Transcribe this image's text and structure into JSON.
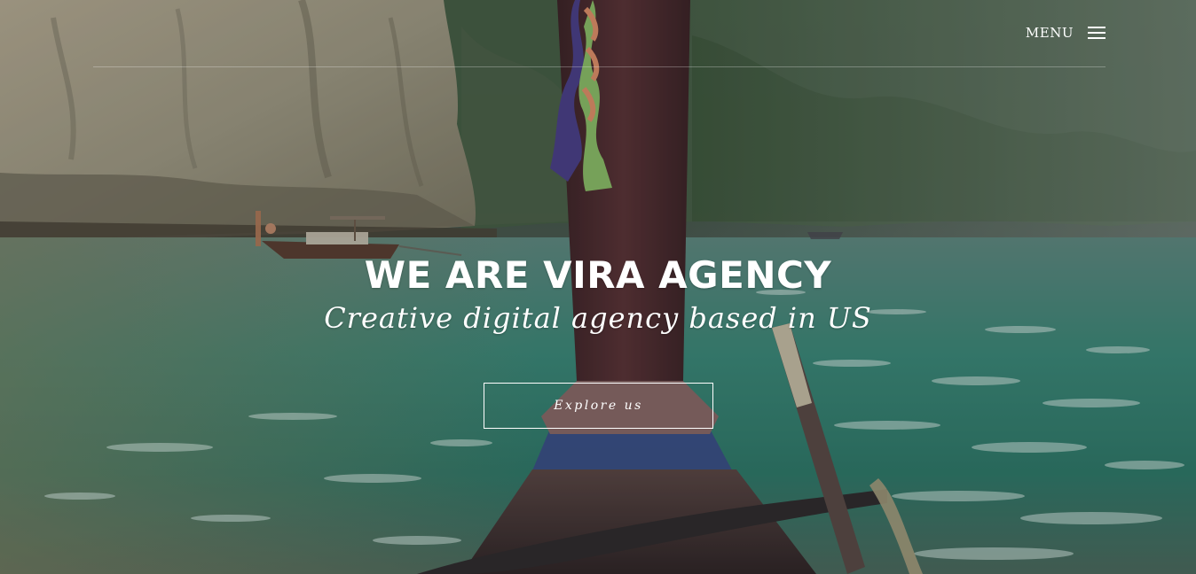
{
  "nav": {
    "menu_label": "MENU",
    "menu_icon": "hamburger-icon"
  },
  "hero": {
    "title": "WE ARE VIRA AGENCY",
    "subtitle": "Creative digital agency based in US",
    "cta_label": "Explore us",
    "background": "photo of a longtail boat bow on turquoise water between limestone cliffs"
  },
  "colors": {
    "text": "#ffffff",
    "water": "#2f8a78",
    "cliff": "#a89f86",
    "forest": "#3e5a3a",
    "boat_post": "#4a2a2c"
  }
}
